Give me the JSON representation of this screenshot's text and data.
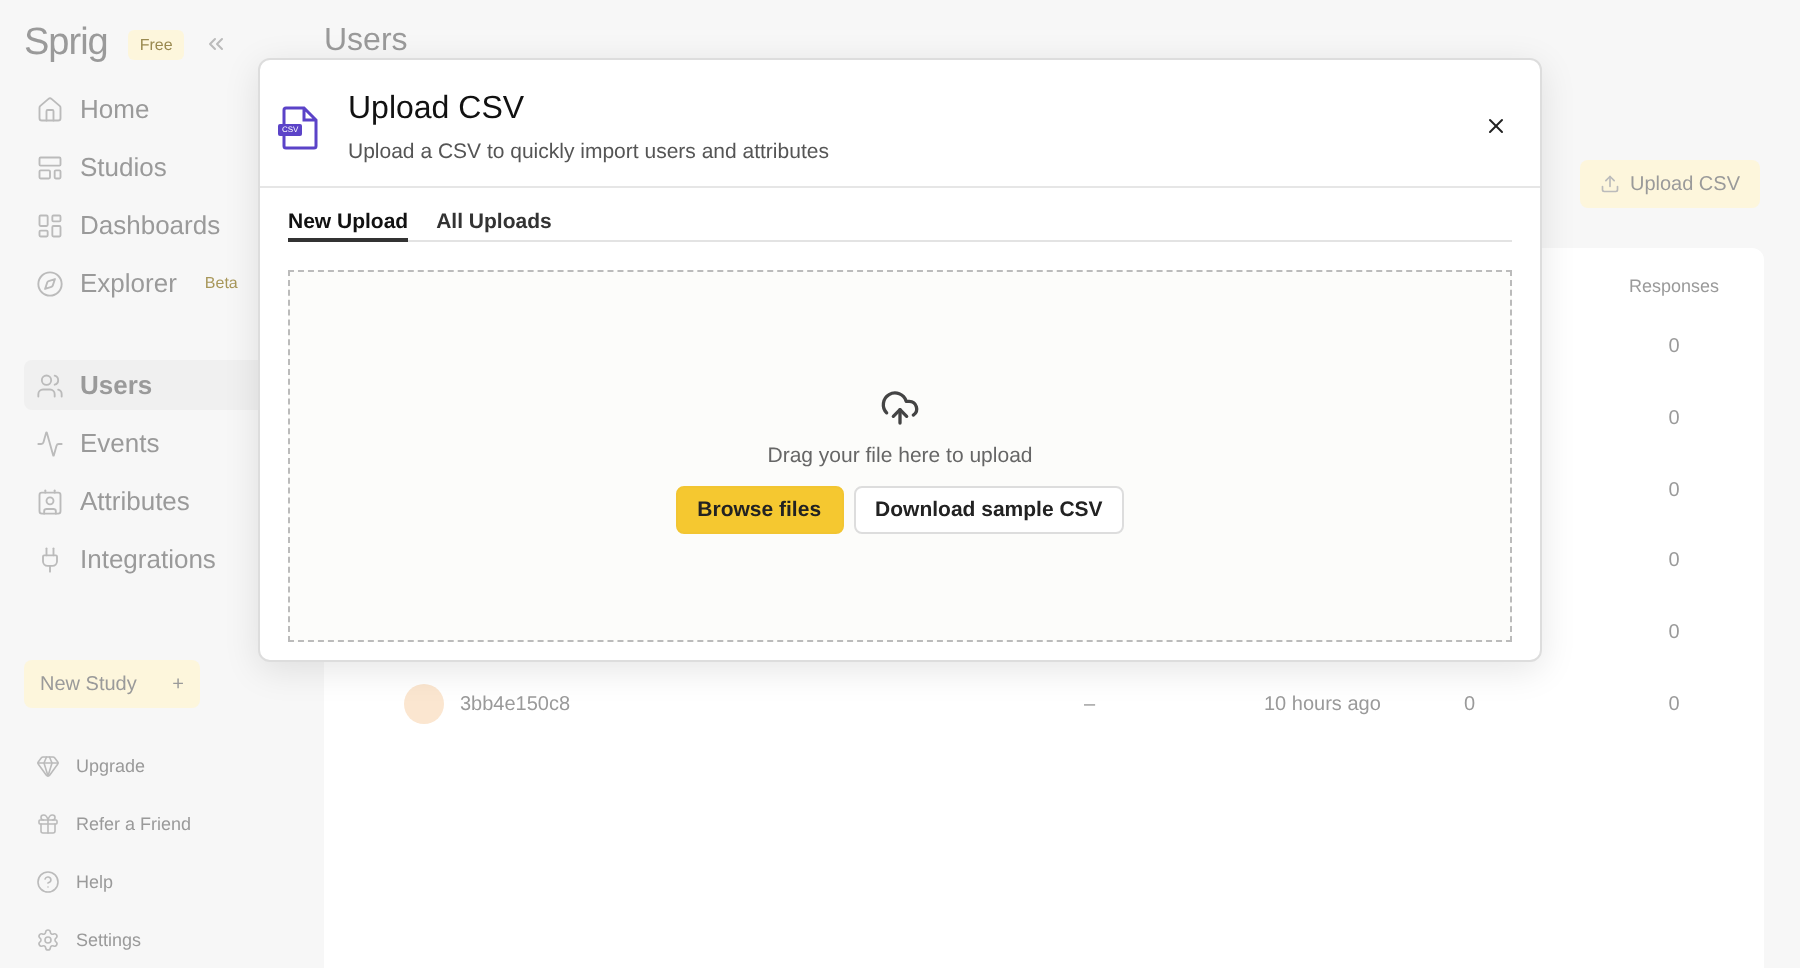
{
  "sidebar": {
    "logo": "Sprig",
    "plan_badge": "Free",
    "nav_main": [
      {
        "label": "Home",
        "selected": false
      },
      {
        "label": "Studios",
        "selected": false
      },
      {
        "label": "Dashboards",
        "selected": false
      },
      {
        "label": "Explorer",
        "selected": false,
        "badge": "Beta"
      }
    ],
    "nav_data": [
      {
        "label": "Users",
        "selected": true
      },
      {
        "label": "Events",
        "selected": false
      },
      {
        "label": "Attributes",
        "selected": false
      },
      {
        "label": "Integrations",
        "selected": false
      }
    ],
    "new_study_button": {
      "label": "New Study",
      "icon_text": "+"
    },
    "footer_items": [
      {
        "label": "Upgrade"
      },
      {
        "label": "Refer a Friend"
      },
      {
        "label": "Help"
      },
      {
        "label": "Settings"
      }
    ]
  },
  "page": {
    "title": "Users",
    "upload_button": "Upload CSV",
    "table": {
      "visible_header": "Responses",
      "rows": [
        {
          "responses": "0"
        },
        {
          "responses": "0"
        },
        {
          "responses": "0"
        },
        {
          "responses": "0"
        },
        {
          "responses": "0"
        },
        {
          "user_id": "3bb4e150c8",
          "column_3": "–",
          "last_seen": "10 hours ago",
          "column_5": "0",
          "responses": "0"
        }
      ]
    }
  },
  "modal": {
    "title": "Upload CSV",
    "subtitle": "Upload a CSV to quickly import users and attributes",
    "file_badge": "CSV",
    "tabs": [
      {
        "label": "New Upload",
        "selected": true
      },
      {
        "label": "All Uploads",
        "selected": false
      }
    ],
    "dropzone": {
      "hint": "Drag your file here to upload",
      "buttons": [
        {
          "label": "Browse files",
          "kind": "primary"
        },
        {
          "label": "Download sample CSV",
          "kind": "secondary"
        }
      ]
    }
  }
}
